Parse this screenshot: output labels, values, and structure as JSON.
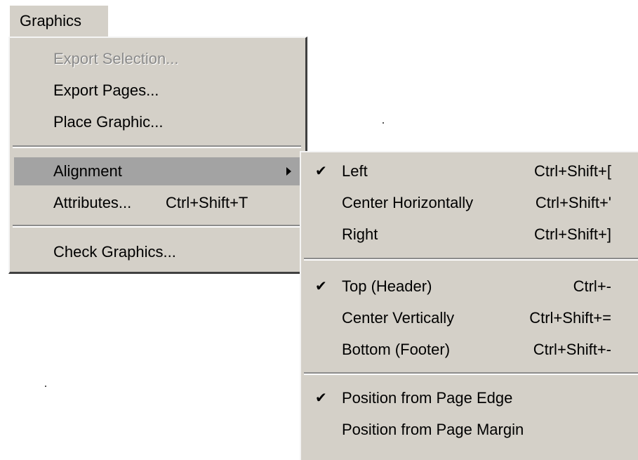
{
  "menubar": {
    "title": "Graphics"
  },
  "graphics_menu": {
    "items": [
      {
        "label": "Export Selection...",
        "disabled": true
      },
      {
        "label": "Export Pages...",
        "disabled": false
      },
      {
        "label": "Place Graphic...",
        "disabled": false
      },
      {
        "label": "Alignment",
        "has_submenu": true,
        "highlighted": true
      },
      {
        "label": "Attributes...",
        "shortcut": "Ctrl+Shift+T"
      },
      {
        "label": "Check Graphics..."
      }
    ]
  },
  "alignment_submenu": {
    "items": [
      {
        "label": "Left",
        "shortcut": "Ctrl+Shift+[",
        "checked": true
      },
      {
        "label": "Center Horizontally",
        "shortcut": "Ctrl+Shift+'",
        "checked": false
      },
      {
        "label": "Right",
        "shortcut": "Ctrl+Shift+]",
        "checked": false
      },
      {
        "label": "Top (Header)",
        "shortcut": "Ctrl+-",
        "checked": true
      },
      {
        "label": "Center Vertically",
        "shortcut": "Ctrl+Shift+=",
        "checked": false
      },
      {
        "label": "Bottom (Footer)",
        "shortcut": "Ctrl+Shift+-",
        "checked": false
      },
      {
        "label": "Position from Page Edge",
        "checked": true
      },
      {
        "label": "Position from Page Margin",
        "checked": false
      }
    ],
    "check_glyph": "✔"
  }
}
